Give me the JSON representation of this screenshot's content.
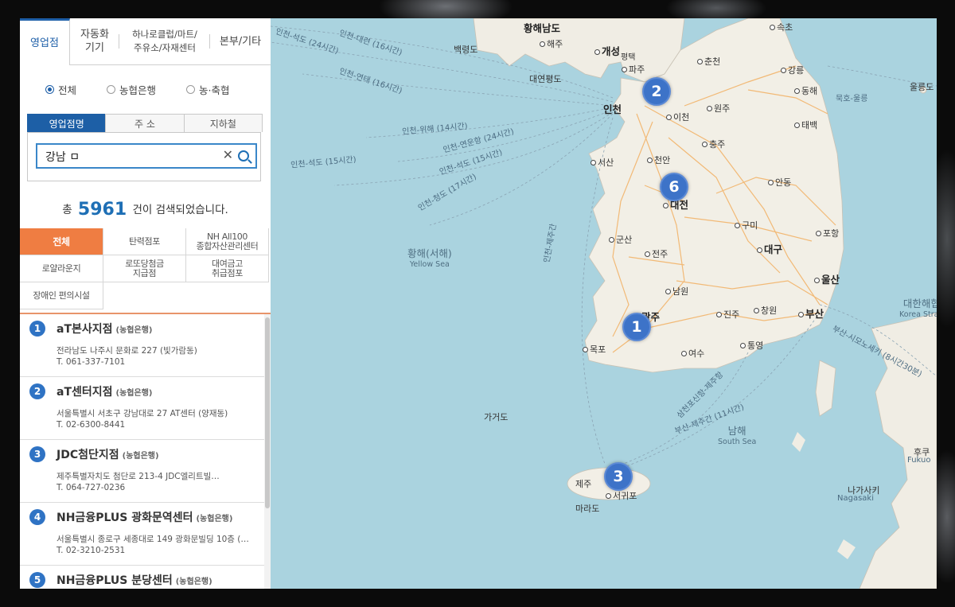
{
  "tabs": [
    {
      "label": "영업점",
      "active": true
    },
    {
      "label": "자동화\n기기",
      "active": false
    },
    {
      "label": "하나로클럽/마트/\n주유소/자재센터",
      "active": false
    },
    {
      "label": "본부/기타",
      "active": false
    }
  ],
  "radios": [
    {
      "label": "전체",
      "checked": true
    },
    {
      "label": "농협은행",
      "checked": false
    },
    {
      "label": "농·축협",
      "checked": false
    }
  ],
  "search_tabs": [
    {
      "label": "영업점명",
      "active": true
    },
    {
      "label": "주 소",
      "active": false
    },
    {
      "label": "지하철",
      "active": false
    }
  ],
  "search": {
    "value": "강남 ㅁ",
    "clear_glyph": "✕"
  },
  "result": {
    "prefix": "총",
    "count": "5961",
    "suffix": "건이 검색되었습니다."
  },
  "filters": [
    {
      "label": "전체",
      "active": true
    },
    {
      "label": "탄력점포",
      "active": false
    },
    {
      "label": "NH All100\n종합자산관리센터",
      "active": false
    },
    {
      "label": "로얄라운지",
      "active": false
    },
    {
      "label": "로또당첨금\n지급점",
      "active": false
    },
    {
      "label": "대여금고\n취급점포",
      "active": false
    },
    {
      "label": "장애인 편의시설",
      "active": false
    }
  ],
  "results": [
    {
      "num": "1",
      "name": "aT본사지점",
      "type": "(농협은행)",
      "address": "전라남도 나주시 문화로 227 (빛가람동)",
      "tel": "T. 061-337-7101"
    },
    {
      "num": "2",
      "name": "aT센터지점",
      "type": "(농협은행)",
      "address": "서울특별시 서초구 강남대로 27 AT센터 (양재동)",
      "tel": "T. 02-6300-8441"
    },
    {
      "num": "3",
      "name": "JDC첨단지점",
      "type": "(농협은행)",
      "address": "제주특별자치도 첨단로 213-4 JDC엘리트빌…",
      "tel": "T. 064-727-0236"
    },
    {
      "num": "4",
      "name": "NH금융PLUS 광화문역센터",
      "type": "(농협은행)",
      "address": "서울특별시 종로구 세종대로 149 광화문빌딩 10층 (…",
      "tel": "T. 02-3210-2531"
    },
    {
      "num": "5",
      "name": "NH금융PLUS 분당센터",
      "type": "(농협은행)",
      "address": "",
      "tel": ""
    }
  ],
  "map": {
    "markers": [
      "2",
      "6",
      "1",
      "3"
    ],
    "cities": [
      "황해남도",
      "해주",
      "개성",
      "파주",
      "춘천",
      "강릉",
      "동해",
      "속초",
      "인천",
      "원주",
      "이천",
      "태백",
      "충주",
      "천안",
      "서산",
      "대전",
      "안동",
      "구미",
      "포항",
      "군산",
      "대구",
      "전주",
      "울산",
      "남원",
      "창원",
      "부산",
      "광주",
      "진주",
      "통영",
      "목포",
      "여수",
      "제주",
      "서귀포",
      "평택",
      "백령도",
      "대연평도",
      "가거도",
      "마라도",
      "울릉도",
      "나가사키",
      "후쿠"
    ],
    "seas": [
      {
        "name": "황해(서해)",
        "en": "Yellow Sea"
      },
      {
        "name": "남해",
        "en": "South Sea"
      },
      {
        "name": "대한해협",
        "en": "Korea Strait"
      }
    ],
    "routes": [
      "인천-대련 (16시간)",
      "인천-석도 (24시간)",
      "인천-연태 (16시간)",
      "인천-위해 (14시간)",
      "인천-연운항 (24시간)",
      "인천-석도 (15시간)",
      "인천-청도 (17시간)",
      "인천-제주간",
      "묵호-울릉",
      "부산-시모노세키 (8시간30분)",
      "삼천포신항-제주항",
      "부산-제주간 (11시간)",
      "Nagasaki",
      "Fukuo"
    ]
  },
  "colors": {
    "accent": "#1e5fa8",
    "filter_active": "#ef7d42",
    "marker": "#3d73c8",
    "sea": "#aad3df",
    "land": "#f2efe6"
  }
}
